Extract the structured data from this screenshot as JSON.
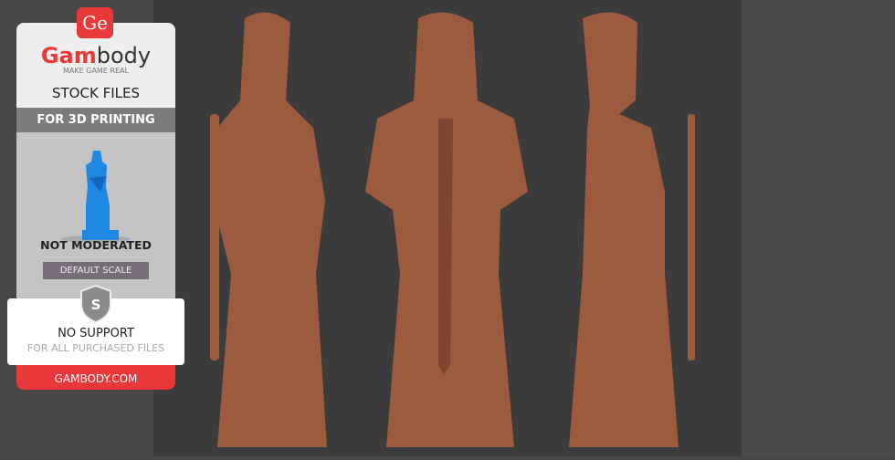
{
  "badge": {
    "logo_text": "Ge",
    "brand_part1": "Gam",
    "brand_part2": "body",
    "tagline": "MAKE GAME REAL",
    "title": "STOCK FILES",
    "subtitle": "FOR 3D PRINTING",
    "moderation": "NOT MODERATED",
    "scale": "DEFAULT SCALE",
    "shield_letter": "S",
    "support": "NO SUPPORT",
    "support_note": "FOR ALL PURCHASED FILES",
    "website": "GAMBODY.COM"
  },
  "colors": {
    "accent": "#e8383a",
    "model": "#a0583c",
    "figure_icon": "#1e88e5"
  }
}
